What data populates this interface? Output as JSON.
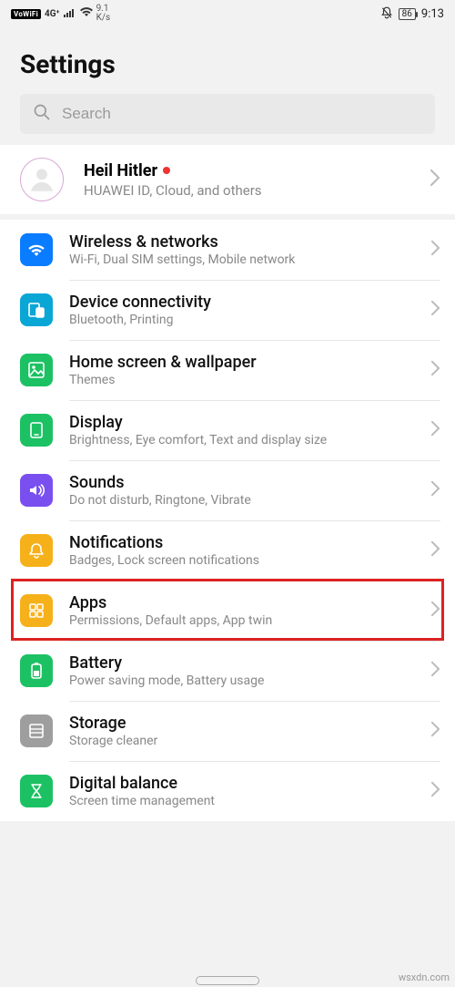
{
  "status": {
    "vowifi": "VoWiFi",
    "net_gen": "4G⁺",
    "speed_top": "9.1",
    "speed_bot": "K/s",
    "battery": "86",
    "time": "9:13"
  },
  "title": "Settings",
  "search": {
    "placeholder": "Search"
  },
  "profile": {
    "name": "Heil Hitler",
    "sub": "HUAWEI ID, Cloud, and others"
  },
  "items": [
    {
      "icon": "wifi",
      "color": "c-blue",
      "title": "Wireless & networks",
      "sub": "Wi-Fi, Dual SIM settings, Mobile network"
    },
    {
      "icon": "devices",
      "color": "c-teal",
      "title": "Device connectivity",
      "sub": "Bluetooth, Printing"
    },
    {
      "icon": "wallpaper",
      "color": "c-green",
      "title": "Home screen & wallpaper",
      "sub": "Themes"
    },
    {
      "icon": "display",
      "color": "c-green2",
      "title": "Display",
      "sub": "Brightness, Eye comfort, Text and display size"
    },
    {
      "icon": "sounds",
      "color": "c-purple",
      "title": "Sounds",
      "sub": "Do not disturb, Ringtone, Vibrate"
    },
    {
      "icon": "bell",
      "color": "c-amber",
      "title": "Notifications",
      "sub": "Badges, Lock screen notifications"
    },
    {
      "icon": "apps",
      "color": "c-amber2",
      "title": "Apps",
      "sub": "Permissions, Default apps, App twin",
      "highlight": true
    },
    {
      "icon": "battery",
      "color": "c-greenB",
      "title": "Battery",
      "sub": "Power saving mode, Battery usage"
    },
    {
      "icon": "storage",
      "color": "c-gray",
      "title": "Storage",
      "sub": "Storage cleaner"
    },
    {
      "icon": "hourglass",
      "color": "c-greenD",
      "title": "Digital balance",
      "sub": "Screen time management"
    }
  ],
  "watermark": "wsxdn.com"
}
